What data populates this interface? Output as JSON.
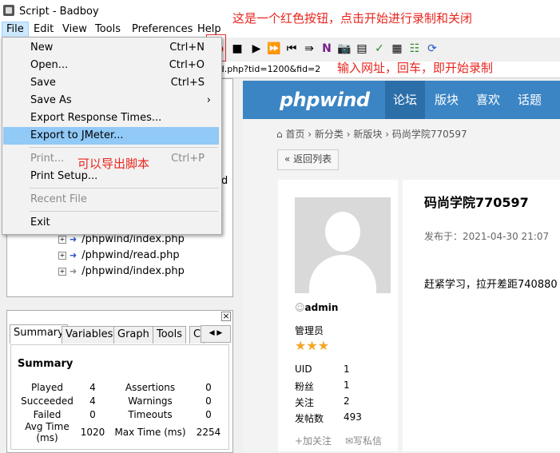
{
  "window": {
    "title": "Script - Badboy"
  },
  "menubar": [
    "File",
    "Edit",
    "View",
    "Tools",
    "Preferences",
    "Help"
  ],
  "file_menu": {
    "new": {
      "label": "New",
      "shortcut": "Ctrl+N"
    },
    "open": {
      "label": "Open...",
      "shortcut": "Ctrl+O"
    },
    "save": {
      "label": "Save",
      "shortcut": "Ctrl+S"
    },
    "save_as": {
      "label": "Save As",
      "submenu": "›"
    },
    "export_response_times": {
      "label": "Export Response Times..."
    },
    "export_jmeter": {
      "label": "Export to JMeter..."
    },
    "print": {
      "label": "Print...",
      "shortcut": "Ctrl+P"
    },
    "print_setup": {
      "label": "Print Setup..."
    },
    "recent_file": {
      "label": "Recent File"
    },
    "exit": {
      "label": "Exit"
    }
  },
  "address": {
    "value": "ad.php?tid=1200&fid=2"
  },
  "tree": {
    "partial_d": "d",
    "items": [
      "/phpwind/index.php",
      "/phpwind/read.php",
      "/phpwind/index.php"
    ]
  },
  "tabs": [
    "Summary",
    "Variables",
    "Graph",
    "Tools",
    "C"
  ],
  "summary": {
    "title": "Summary",
    "rows": [
      {
        "l1": "Played",
        "v1": "4",
        "l2": "Assertions",
        "v2": "0"
      },
      {
        "l1": "Succeeded",
        "v1": "4",
        "l2": "Warnings",
        "v2": "0"
      },
      {
        "l1": "Failed",
        "v1": "0",
        "l2": "Timeouts",
        "v2": "0"
      },
      {
        "l1": "Avg Time (ms)",
        "v1": "1020",
        "l2": "Max Time (ms)",
        "v2": "2254"
      }
    ]
  },
  "annotations": {
    "record": "这是一个红色按钮，点击开始进行录制和关闭",
    "url": "输入网址，回车，即开始录制",
    "export": "可以导出脚本"
  },
  "web": {
    "logo": "phpwind",
    "nav": [
      "论坛",
      "版块",
      "喜欢",
      "话题"
    ],
    "breadcrumb": [
      "首页",
      "新分类",
      "新版块",
      "码尚学院770597"
    ],
    "back_button": "« 返回列表",
    "post_title": "码尚学院770597",
    "post_date": "发布于：2021-04-30 21:07",
    "post_body": "赶紧学习，拉开差距740880",
    "user": {
      "name": "admin",
      "role": "管理员",
      "stars": "★★★",
      "stats": [
        {
          "k": "UID",
          "v": "1"
        },
        {
          "k": "粉丝",
          "v": "1"
        },
        {
          "k": "关注",
          "v": "2"
        },
        {
          "k": "发帖数",
          "v": "493"
        }
      ],
      "follow": "+加关注",
      "message": "✉写私信"
    }
  },
  "colors": {
    "accent": "#3b85c4",
    "annotation": "#e8251e",
    "highlight": "#91c9f7"
  }
}
